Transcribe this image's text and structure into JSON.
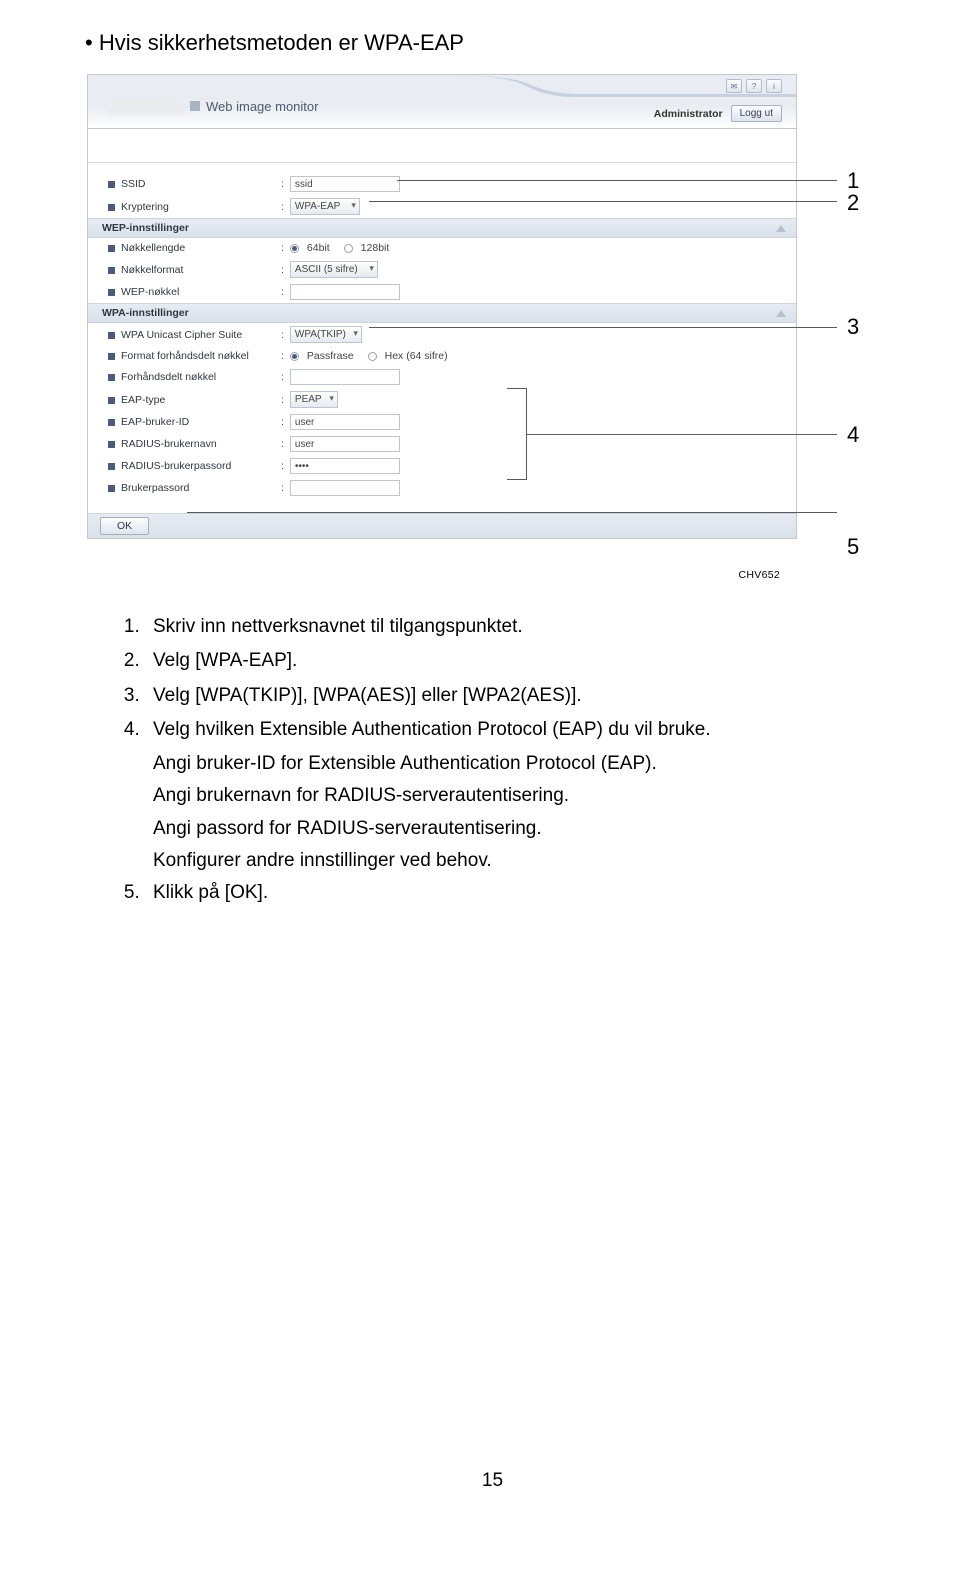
{
  "title": "Hvis sikkerhetsmetoden er WPA-EAP",
  "code_ref": "CHV652",
  "callouts": {
    "n1": "1",
    "n2": "2",
    "n3": "3",
    "n4": "4",
    "n5": "5"
  },
  "screenshot": {
    "header": {
      "title": "Web image monitor",
      "icons": {
        "mail": "✉",
        "help": "?",
        "info": "i"
      },
      "admin_label": "Administrator",
      "logout_btn": "Logg ut"
    },
    "fields": {
      "ssid_label": "SSID",
      "ssid_value": "ssid",
      "enc_label": "Kryptering",
      "enc_value": "WPA-EAP",
      "wep_section": "WEP-innstillinger",
      "keylen_label": "Nøkkellengde",
      "keylen_opt1": "64bit",
      "keylen_opt2": "128bit",
      "keyfmt_label": "Nøkkelformat",
      "keyfmt_value": "ASCII (5 sifre)",
      "wepkey_label": "WEP-nøkkel",
      "wpa_section": "WPA-innstillinger",
      "cipher_label": "WPA Unicast Cipher Suite",
      "cipher_value": "WPA(TKIP)",
      "pskfmt_label": "Format forhåndsdelt nøkkel",
      "pskfmt_opt1": "Passfrase",
      "pskfmt_opt2": "Hex (64 sifre)",
      "psk_label": "Forhåndsdelt nøkkel",
      "eaptype_label": "EAP-type",
      "eaptype_value": "PEAP",
      "eapuser_label": "EAP-bruker-ID",
      "eapuser_value": "user",
      "radname_label": "RADIUS-brukernavn",
      "radname_value": "user",
      "radpass_label": "RADIUS-brukerpassord",
      "radpass_value": "••••",
      "userpass_label": "Brukerpassord"
    },
    "ok_btn": "OK"
  },
  "steps": {
    "s1": "Skriv inn nettverksnavnet til tilgangspunktet.",
    "s2": "Velg [WPA-EAP].",
    "s3": "Velg [WPA(TKIP)], [WPA(AES)] eller [WPA2(AES)].",
    "s4": "Velg hvilken Extensible Authentication Protocol (EAP) du vil bruke.",
    "s4a": "Angi bruker-ID for Extensible Authentication Protocol (EAP).",
    "s4b": "Angi brukernavn for RADIUS-serverautentisering.",
    "s4c": "Angi passord for RADIUS-serverautentisering.",
    "s4d": "Konfigurer andre innstillinger ved behov.",
    "s5": "Klikk på [OK]."
  },
  "page_num": "15"
}
